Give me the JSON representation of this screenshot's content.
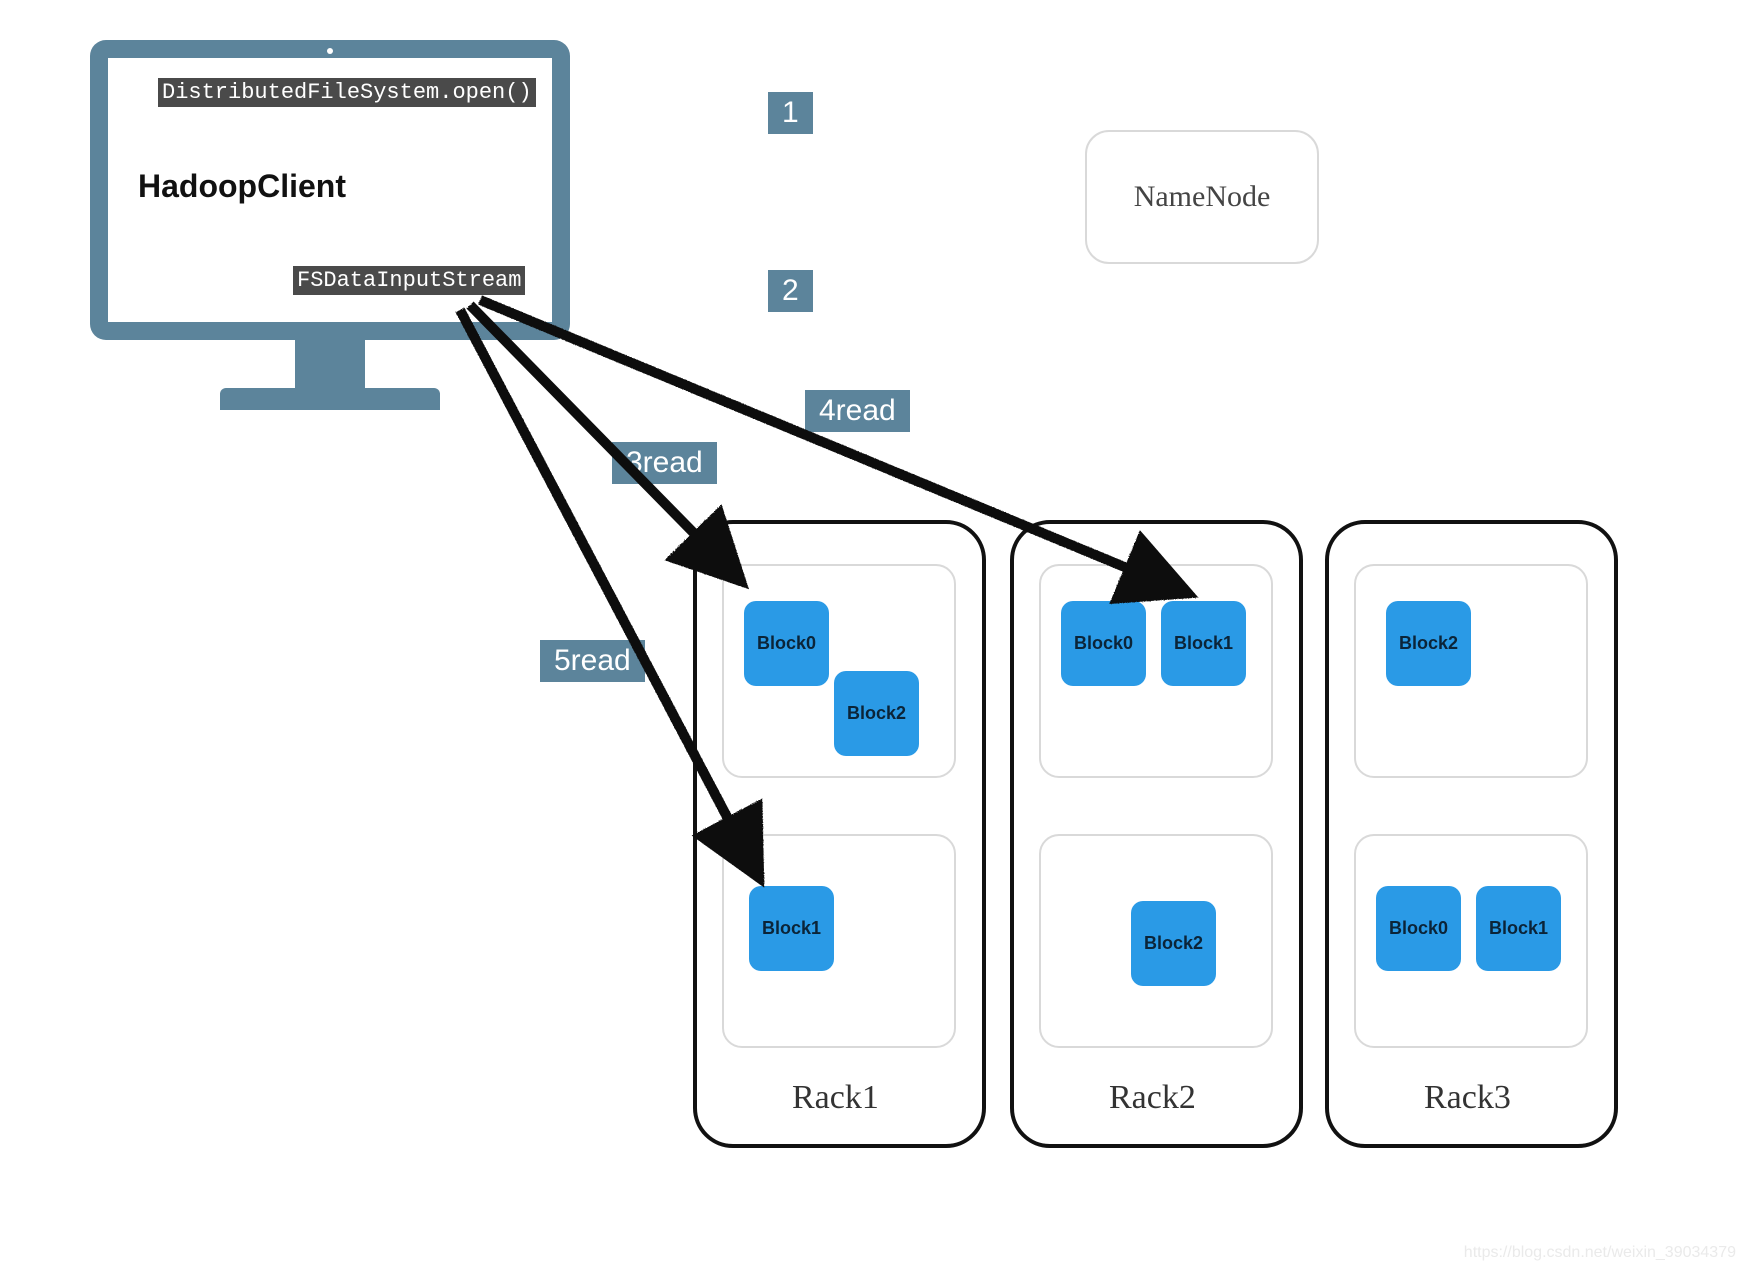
{
  "client": {
    "title": "HadoopClient",
    "open_call": "DistributedFileSystem.open()",
    "input_stream": "FSDataInputStream"
  },
  "namenode": {
    "label": "NameNode"
  },
  "steps": {
    "s1": "1",
    "s2": "2",
    "s3": "3read",
    "s4": "4read",
    "s5": "5read"
  },
  "racks": [
    {
      "label": "Rack1",
      "top_blocks": [
        "Block0",
        "Block2"
      ],
      "bottom_blocks": [
        "Block1"
      ]
    },
    {
      "label": "Rack2",
      "top_blocks": [
        "Block0",
        "Block1"
      ],
      "bottom_blocks": [
        "Block2"
      ]
    },
    {
      "label": "Rack3",
      "top_blocks": [
        "Block2"
      ],
      "bottom_blocks": [
        "Block0",
        "Block1"
      ]
    }
  ],
  "watermark": "https://blog.csdn.net/weixin_39034379"
}
